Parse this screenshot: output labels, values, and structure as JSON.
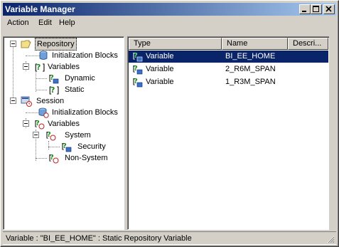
{
  "window": {
    "title": "Variable Manager"
  },
  "menu": [
    "Action",
    "Edit",
    "Help"
  ],
  "tree": {
    "repository": "Repository",
    "repo_init_blocks": "Initialization Blocks",
    "repo_variables": "Variables",
    "dynamic": "Dynamic",
    "static": "Static",
    "session": "Session",
    "session_init_blocks": "Initialization Blocks",
    "session_variables": "Variables",
    "system": "System",
    "security": "Security",
    "non_system": "Non-System"
  },
  "list": {
    "columns": [
      "Type",
      "Name",
      "Descri..."
    ],
    "rows": [
      {
        "type": "Variable",
        "name": "BI_EE_HOME",
        "selected": true
      },
      {
        "type": "Variable",
        "name": "2_R6M_SPAN",
        "selected": false
      },
      {
        "type": "Variable",
        "name": "1_R3M_SPAN",
        "selected": false
      }
    ]
  },
  "status": {
    "text": "Variable : \"BI_EE_HOME\" : Static Repository Variable"
  },
  "colors": {
    "title_start": "#0a246a",
    "title_end": "#a6caf0",
    "selection": "#0a246a",
    "chrome": "#d4d0c8"
  }
}
